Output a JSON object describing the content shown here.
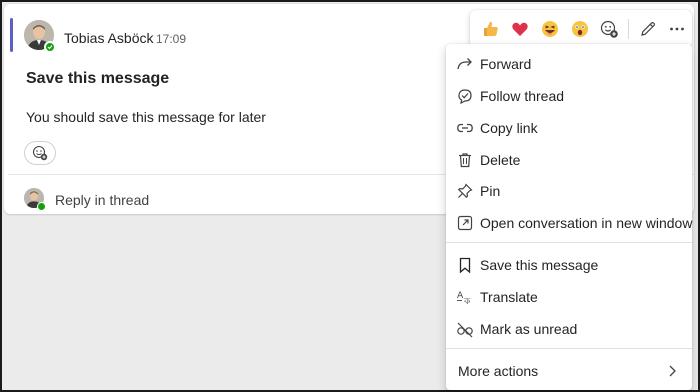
{
  "message": {
    "author": "Tobias Asböck",
    "time": "17:09",
    "subject": "Save this message",
    "body": "You should save this message for later",
    "reply_label": "Reply in thread"
  },
  "toolbar": {
    "reactions": [
      "like-icon",
      "heart-icon",
      "laugh-icon",
      "surprised-icon"
    ],
    "more_reactions_icon": "add-reaction-icon",
    "edit_icon": "pencil-icon",
    "more_icon": "ellipsis-icon"
  },
  "menu": {
    "items": [
      {
        "label": "Forward",
        "icon": "forward-icon"
      },
      {
        "label": "Follow thread",
        "icon": "follow-thread-icon"
      },
      {
        "label": "Copy link",
        "icon": "link-icon"
      },
      {
        "label": "Delete",
        "icon": "trash-icon"
      },
      {
        "label": "Pin",
        "icon": "pin-icon"
      },
      {
        "label": "Open conversation in new window",
        "icon": "open-external-icon"
      }
    ],
    "group2": [
      {
        "label": "Save this message",
        "icon": "bookmark-icon",
        "highlighted": true
      },
      {
        "label": "Translate",
        "icon": "translate-icon"
      },
      {
        "label": "Mark as unread",
        "icon": "unread-icon"
      }
    ],
    "more_actions": "More actions"
  },
  "colors": {
    "accent": "#5b5fc7",
    "presence": "#13a10e",
    "highlight": "#fbf53a"
  }
}
